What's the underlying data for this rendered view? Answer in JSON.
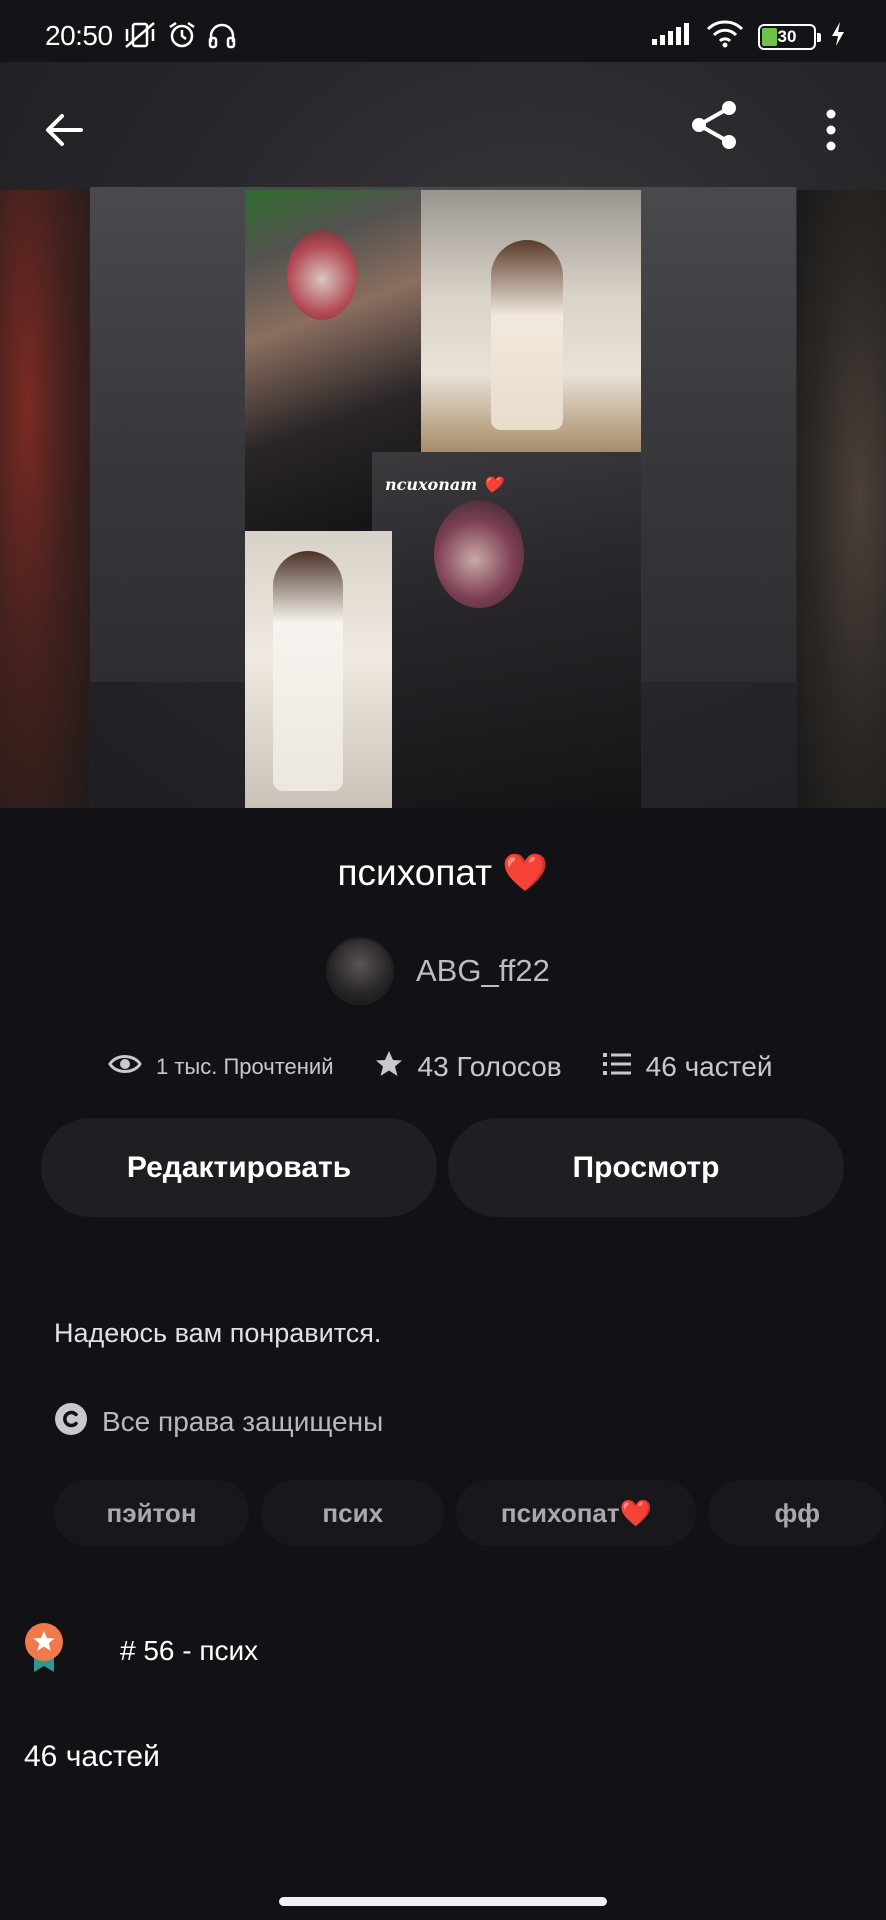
{
  "status_bar": {
    "time": "20:50",
    "battery_level": "30",
    "battery_percent": 30
  },
  "story": {
    "title": "психопат ❤️",
    "cover_caption": "психопат ❤️",
    "author": "ABG_ff22",
    "description": "Надеюсь вам понравится.",
    "copyright": "Все права защищены",
    "parts_count": "46 частей"
  },
  "stats": {
    "views": "1 тыс. Прочтений",
    "votes": "43 Голосов",
    "parts": "46 частей"
  },
  "actions": {
    "edit_label": "Редактировать",
    "preview_label": "Просмотр"
  },
  "tags": [
    "пэйтон",
    "псих",
    "психопат❤️",
    "фф"
  ],
  "rank": {
    "text": "# 56 - псих"
  },
  "icons": {
    "back": "arrow-left-icon",
    "share": "share-icon",
    "more": "more-vertical-icon",
    "views": "eye-icon",
    "votes": "star-icon",
    "parts": "list-icon",
    "copyright": "copyright-icon",
    "rank": "award-badge-icon"
  },
  "colors": {
    "background": "#121115",
    "button_bg": "#1f1e22",
    "text_muted": "#c9c8ce",
    "badge_orange": "#f07a4a",
    "badge_teal": "#2c9a8f",
    "battery_green": "#6ec24a"
  }
}
